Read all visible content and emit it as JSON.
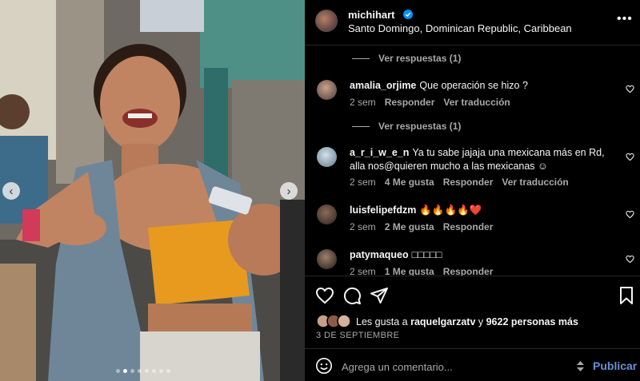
{
  "post": {
    "username": "michihart",
    "location": "Santo Domingo, Dominican Republic, Caribbean",
    "verified": true
  },
  "carousel": {
    "slides": 8,
    "current": 2,
    "prev_icon": "chevron-left-icon",
    "next_icon": "chevron-right-icon"
  },
  "comments": {
    "view_replies_1": "Ver respuestas (1)",
    "view_replies_2": "Ver respuestas (1)",
    "items": [
      {
        "user": "amalia_orjime",
        "text": "Que operación se hizo ?",
        "time": "2 sem",
        "likes": "",
        "reply": "Responder",
        "translate": "Ver traducción"
      },
      {
        "user": "a_r_i_w_e_n",
        "text": "Ya tu sabe jajaja una mexicana más en Rd, alla nos@quieren mucho a las mexicanas ☺",
        "time": "2 sem",
        "likes": "4 Me gusta",
        "reply": "Responder",
        "translate": "Ver traducción"
      },
      {
        "user": "luisfelipefdzm",
        "text": "🔥🔥🔥🔥❤️",
        "time": "2 sem",
        "likes": "2 Me gusta",
        "reply": "Responder",
        "translate": ""
      },
      {
        "user": "patymaqueo",
        "text": "□□□□□",
        "time": "2 sem",
        "likes": "1 Me gusta",
        "reply": "Responder",
        "translate": ""
      }
    ]
  },
  "actions": {
    "like_icon": "heart-icon",
    "comment_icon": "comment-icon",
    "share_icon": "send-icon",
    "save_icon": "bookmark-icon"
  },
  "likes": {
    "prefix": "Les gusta a ",
    "user": "raquelgarzatv",
    "middle": " y ",
    "count": "9622 personas más"
  },
  "date": "3 DE SEPTIEMBRE",
  "add_comment": {
    "placeholder": "Agrega un comentario...",
    "publish_label": "Publicar"
  },
  "colors": {
    "background": "#000000",
    "text": "#f5f5f5",
    "muted": "#a8a8a8",
    "link": "#6a8fd8",
    "verified": "#0095f6",
    "heart": "#ed4956"
  }
}
